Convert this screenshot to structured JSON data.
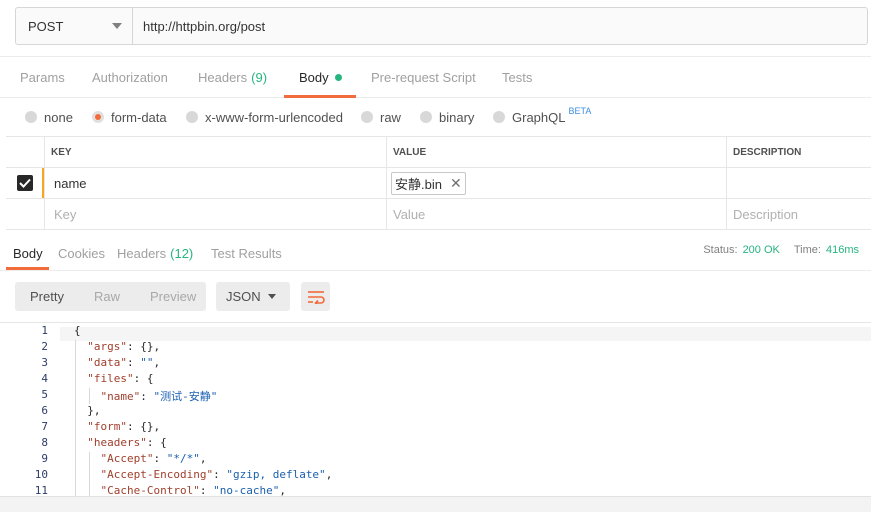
{
  "request": {
    "method": "POST",
    "url": "http://httpbin.org/post",
    "tabs": [
      {
        "label": "Params"
      },
      {
        "label": "Authorization"
      },
      {
        "label": "Headers",
        "count": "(9)"
      },
      {
        "label": "Body"
      },
      {
        "label": "Pre-request Script"
      },
      {
        "label": "Tests"
      }
    ],
    "active_tab": "Body",
    "body_types": [
      "none",
      "form-data",
      "x-www-form-urlencoded",
      "raw",
      "binary",
      "GraphQL"
    ],
    "selected_body_type": "form-data",
    "beta_badge": "BETA"
  },
  "form_table": {
    "headers": [
      "KEY",
      "VALUE",
      "DESCRIPTION"
    ],
    "rows": [
      {
        "checked": true,
        "key": "name",
        "value_file": "安静.bin",
        "description": ""
      }
    ],
    "placeholders": {
      "key": "Key",
      "value": "Value",
      "description": "Description"
    }
  },
  "response": {
    "tabs": [
      {
        "label": "Body"
      },
      {
        "label": "Cookies"
      },
      {
        "label": "Headers",
        "count": "(12)"
      },
      {
        "label": "Test Results"
      }
    ],
    "active_tab": "Body",
    "status_label": "Status:",
    "status_value": "200 OK",
    "time_label": "Time:",
    "time_value": "416ms",
    "view_modes": [
      "Pretty",
      "Raw",
      "Preview"
    ],
    "active_view": "Pretty",
    "format": "JSON",
    "code_lines": [
      "{",
      "  \"args\": {},",
      "  \"data\": \"\",",
      "  \"files\": {",
      "    \"name\": \"测试-安静\"",
      "  },",
      "  \"form\": {},",
      "  \"headers\": {",
      "    \"Accept\": \"*/*\",",
      "    \"Accept-Encoding\": \"gzip, deflate\",",
      "    \"Cache-Control\": \"no-cache\","
    ]
  },
  "colors": {
    "accent": "#f26b3a",
    "success": "#26b47f",
    "json_key": "#a0402d",
    "json_string": "#1b5fb0"
  }
}
